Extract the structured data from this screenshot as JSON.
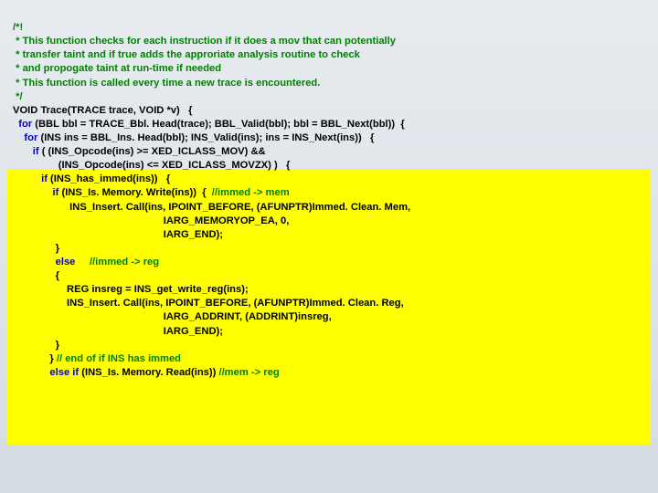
{
  "code": {
    "c1": "/*!",
    "c2": " * This function checks for each instruction if it does a mov that can potentially",
    "c3": " * transfer taint and if true adds the approriate analysis routine to check",
    "c4": " * and propogate taint at run-time if needed",
    "c5": " * This function is called every time a new trace is encountered.",
    "c6": " */",
    "l1a": "VOID Trace(TRACE trace, VOID *v)   {",
    "l2a": "  for",
    "l2b": " (BBL bbl = TRACE_Bbl. Head(trace); BBL_Valid(bbl); bbl = BBL_Next(bbl))  {",
    "l3a": "    for",
    "l3b": " (INS ins = BBL_Ins. Head(bbl); INS_Valid(ins); ins = INS_Next(ins))   {",
    "l4a": "       if",
    "l4b": " ( (INS_Opcode(ins) >= XED_ICLASS_MOV) &&",
    "l5": "                (INS_Opcode(ins) <= XED_ICLASS_MOVZX) )   {",
    "l6a": "          if",
    "l6b": " (INS_has_immed(ins))   {",
    "l7a": "              if",
    "l7b": " (INS_Is. Memory. Write(ins))  {  ",
    "l7c": "//immed -> mem",
    "l8": "                    INS_Insert. Call(ins, IPOINT_BEFORE, (AFUNPTR)Immed. Clean. Mem,",
    "l9": "                                                     IARG_MEMORYOP_EA, 0,",
    "l10": "                                                     IARG_END);",
    "l11": "               }",
    "l12a": "               else",
    "l12b": "     //immed -> reg",
    "l13": "               {",
    "l14": "                   REG insreg = INS_get_write_reg(ins);",
    "l15": "                   INS_Insert. Call(ins, IPOINT_BEFORE, (AFUNPTR)Immed. Clean. Reg,",
    "l16": "                                                     IARG_ADDRINT, (ADDRINT)insreg,",
    "l17": "                                                     IARG_END);",
    "l18": "               }",
    "l19a": "             } ",
    "l19b": "// end of if INS has immed",
    "l20a": "             else if",
    "l20b": " (INS_Is. Memory. Read(ins)) ",
    "l20c": "//mem -> reg"
  }
}
